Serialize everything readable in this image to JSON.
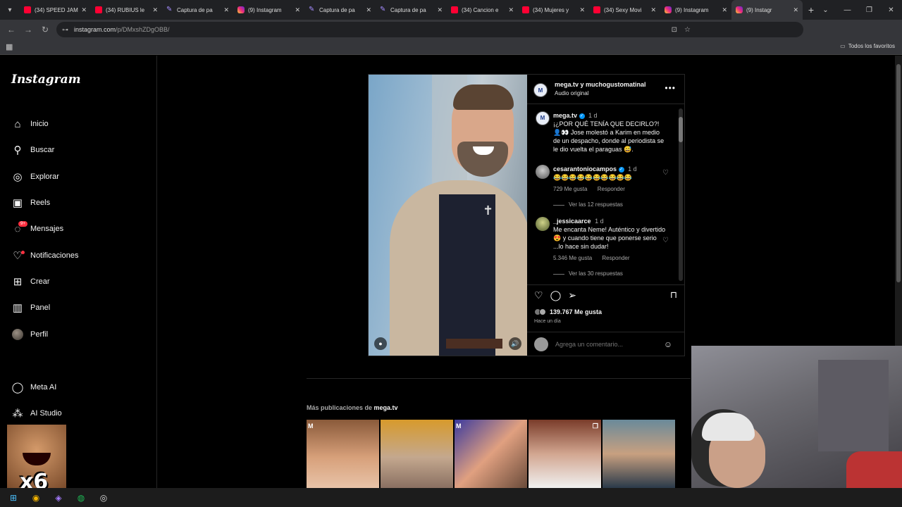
{
  "browser": {
    "tabs": [
      {
        "label": "(34) SPEED JAM",
        "favicon": "youtube-icon"
      },
      {
        "label": "(34) RUBIUS le",
        "favicon": "youtube-icon"
      },
      {
        "label": "Captura de pa",
        "favicon": "pen-icon"
      },
      {
        "label": "(9) Instagram",
        "favicon": "instagram-icon"
      },
      {
        "label": "Captura de pa",
        "favicon": "pen-icon"
      },
      {
        "label": "Captura de pa",
        "favicon": "pen-icon"
      },
      {
        "label": "(34) Cancion e",
        "favicon": "youtube-icon"
      },
      {
        "label": "(34) Mujeres y",
        "favicon": "youtube-icon"
      },
      {
        "label": "(34) Sexy Movi",
        "favicon": "youtube-icon"
      },
      {
        "label": "(9) Instagram",
        "favicon": "instagram-icon"
      },
      {
        "label": "(9) Instagr",
        "favicon": "instagram-icon"
      }
    ],
    "url_host": "instagram.com",
    "url_path": "/p/DMxshZDgOBB/",
    "bookmarks_label": "Todos los favoritos"
  },
  "instagram": {
    "logo": "Instagram",
    "nav": [
      {
        "label": "Inicio",
        "icon": "home-icon"
      },
      {
        "label": "Buscar",
        "icon": "search-icon"
      },
      {
        "label": "Explorar",
        "icon": "compass-icon"
      },
      {
        "label": "Reels",
        "icon": "reels-icon"
      },
      {
        "label": "Mensajes",
        "icon": "messenger-icon",
        "badge": "9+"
      },
      {
        "label": "Notificaciones",
        "icon": "heart-icon"
      },
      {
        "label": "Crear",
        "icon": "plus-icon"
      },
      {
        "label": "Panel",
        "icon": "chart-icon"
      },
      {
        "label": "Perfil",
        "icon": "avatar"
      }
    ],
    "nav_bottom": [
      {
        "label": "Meta AI",
        "icon": "meta-ai-icon"
      },
      {
        "label": "AI Studio",
        "icon": "ai-studio-icon"
      }
    ],
    "post": {
      "header_names": "mega.tv y muchogustomatinal",
      "header_audio": "Audio original",
      "caption": {
        "user": "mega.tv",
        "time": "1 d",
        "text": "¡¿POR QUÉ TENÍA QUE DECIRLO?! 👤👀 Jose molestó a Karim en medio de un despacho, donde al periodista se le dio vuelta el paraguas 😅."
      },
      "comments": [
        {
          "user": "cesarantoniocampos",
          "time": "1 d",
          "text": "😂😂😂😂😂😂😂😂😂😂",
          "likes": "729 Me gusta",
          "reply": "Responder",
          "replies": "Ver las 12 respuestas"
        },
        {
          "user": "_jessicaarce",
          "time": "1 d",
          "text": "Me encanta Neme! Auténtico y divertido 😍 y cuando tiene que ponerse serio ...lo hace sin dudar!",
          "likes": "5.346 Me gusta",
          "reply": "Responder",
          "replies": "Ver las 30 respuestas"
        }
      ],
      "like_count": "139.767 Me gusta",
      "posted_ago": "Hace un día",
      "comment_placeholder": "Agrega un comentario..."
    },
    "more_posts_prefix": "Más publicaciones de",
    "more_posts_user": "mega.tv"
  },
  "overlay": {
    "meme_text": "x6"
  }
}
